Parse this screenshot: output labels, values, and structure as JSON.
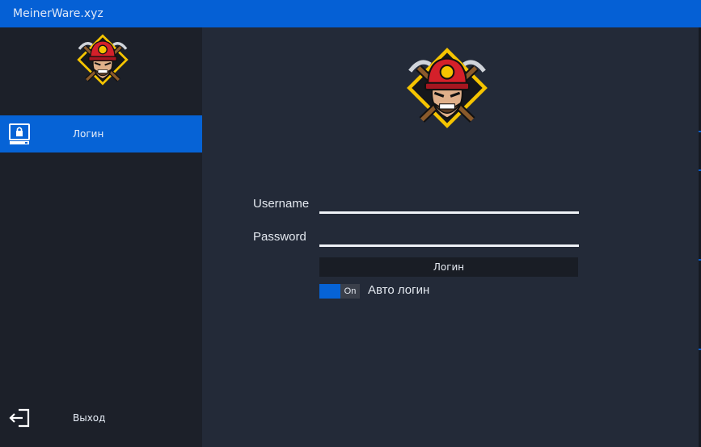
{
  "app": {
    "title": "MeinerWare.xyz"
  },
  "sidebar": {
    "items": [
      {
        "label": "Логин",
        "icon": "monitor-lock-icon"
      },
      {
        "label": "Выход",
        "icon": "exit-icon"
      }
    ]
  },
  "login_form": {
    "username_label": "Username",
    "username_value": "",
    "password_label": "Password",
    "password_value": "",
    "submit_label": "Логин",
    "auto_login": {
      "state": "On",
      "label": "Авто логин"
    }
  },
  "colors": {
    "accent": "#0663d6",
    "sidebar_bg": "#1c2029",
    "main_bg": "#232a38",
    "logo_yellow": "#f5c400",
    "helmet_red": "#d4202a"
  }
}
